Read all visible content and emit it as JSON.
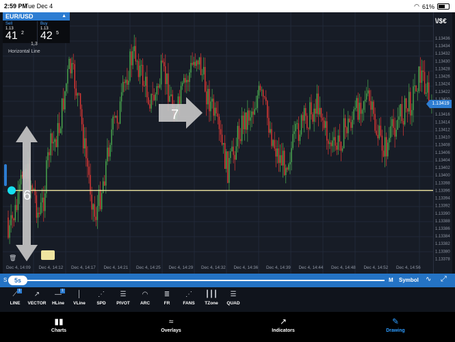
{
  "status": {
    "time": "2:59 PM",
    "date": "Tue Dec 4",
    "battery": "61%",
    "battery_level": 0.61
  },
  "ticker": {
    "symbol": "EUR/USD",
    "sell": {
      "label": "Sell",
      "prefix": "1.13",
      "big": "41",
      "sup": "2"
    },
    "buy": {
      "label": "Buy",
      "prefix": "1.13",
      "big": "42",
      "sup": "5"
    },
    "spread": "1,3"
  },
  "drawing_label": "Horizontal Line",
  "symbol_button": "\\/$€",
  "current_price": "1.13419",
  "horizontal_line_price": 1.13396,
  "price_axis": [
    "1.13436",
    "1.13434",
    "1.13432",
    "1.13430",
    "1.13428",
    "1.13426",
    "1.13424",
    "1.13422",
    "1.13420",
    "1.13418",
    "1.13416",
    "1.13414",
    "1.13412",
    "1.13410",
    "1.13408",
    "1.13406",
    "1.13404",
    "1.13402",
    "1.13400",
    "1.13398",
    "1.13396",
    "1.13394",
    "1.13392",
    "1.13390",
    "1.13388",
    "1.13386",
    "1.13384",
    "1.13382",
    "1.13380",
    "1.13378"
  ],
  "time_axis": [
    "Dec 4, 14:09",
    "Dec 4, 14:12",
    "Dec 4, 14:17",
    "Dec 4, 14:21",
    "Dec 4, 14:25",
    "Dec 4, 14:29",
    "Dec 4, 14:32",
    "Dec 4, 14:36",
    "Dec 4, 14:39",
    "Dec 4, 14:44",
    "Dec 4, 14:48",
    "Dec 4, 14:52",
    "Dec 4, 14:56"
  ],
  "annotations": {
    "arrow_6": "6",
    "arrow_7": "7"
  },
  "timeframe": {
    "value": "5s",
    "left": "S",
    "right": "M",
    "symbol": "Symbol"
  },
  "tools": [
    {
      "label": "LINE",
      "icon": "line-tool-icon",
      "glyph": "⟋",
      "badge": "1"
    },
    {
      "label": "VECTOR",
      "icon": "vector-tool-icon",
      "glyph": "↗"
    },
    {
      "label": "HLine",
      "icon": "hline-tool-icon",
      "glyph": "—",
      "badge": "1"
    },
    {
      "label": "VLine",
      "icon": "vline-tool-icon",
      "glyph": "│"
    },
    {
      "label": "SPD",
      "icon": "speed-lines-icon",
      "glyph": "⋰"
    },
    {
      "label": "PIVOT",
      "icon": "pivot-icon",
      "glyph": "☰"
    },
    {
      "label": "ARC",
      "icon": "arc-icon",
      "glyph": "◠"
    },
    {
      "label": "FR",
      "icon": "fibonacci-retracement-icon",
      "glyph": "≣"
    },
    {
      "label": "FANS",
      "icon": "fans-icon",
      "glyph": "⋰"
    },
    {
      "label": "TZone",
      "icon": "time-zone-icon",
      "glyph": "┃┃┃"
    },
    {
      "label": "QUAD",
      "icon": "quadrant-icon",
      "glyph": "☰"
    }
  ],
  "tabs": [
    {
      "label": "Charts",
      "icon": "chart-bars-icon",
      "glyph": "▮▮"
    },
    {
      "label": "Overlays",
      "icon": "overlays-wave-icon",
      "glyph": "≈"
    },
    {
      "label": "Indicators",
      "icon": "indicators-trend-icon",
      "glyph": "↗"
    },
    {
      "label": "Drawing",
      "icon": "drawing-pencil-icon",
      "glyph": "✎",
      "active": true
    }
  ],
  "colors": {
    "accent": "#2d7dd2",
    "up": "#4caf50",
    "down": "#e53935",
    "hline": "#f1e7a0",
    "chart_bg": "#171c26"
  }
}
